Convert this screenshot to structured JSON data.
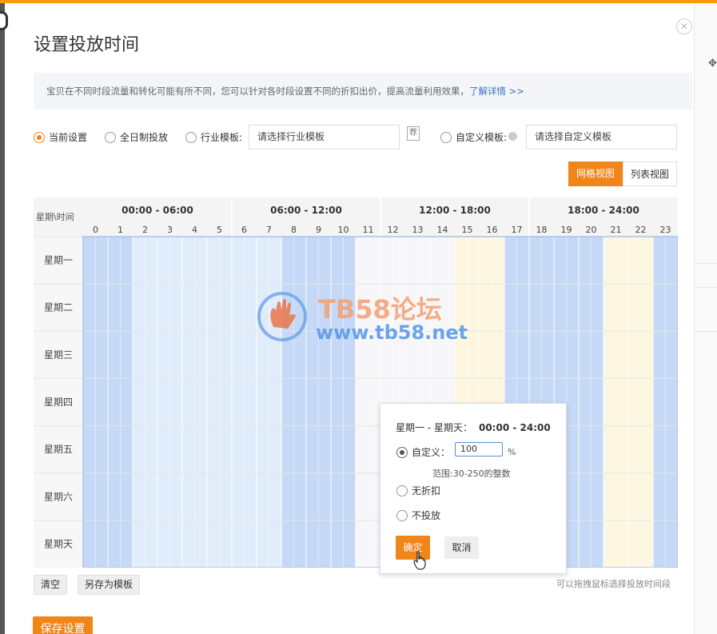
{
  "dialog": {
    "title": "设置投放时间",
    "close_icon": "close-circle-icon",
    "tip_text": "宝贝在不同时段流量和转化可能有所不同，您可以针对各时段设置不同的折扣出价，提高流量利用效果，",
    "tip_link": "了解详情 >>"
  },
  "options": {
    "current": "当前设置",
    "fullday": "全日制投放",
    "industry": "行业模板:",
    "industry_placeholder": "请选择行业模板",
    "custom": "自定义模板:",
    "custom_placeholder": "请选择自定义模板",
    "selected": "current"
  },
  "view_tabs": {
    "grid": "网格视图",
    "list": "列表视图",
    "active": "grid"
  },
  "schedule": {
    "corner_label": "星期\\时间",
    "ranges": [
      "00:00 - 06:00",
      "06:00 - 12:00",
      "12:00 - 18:00",
      "18:00 - 24:00"
    ],
    "hours": [
      "0",
      "1",
      "2",
      "3",
      "4",
      "5",
      "6",
      "7",
      "8",
      "9",
      "10",
      "11",
      "12",
      "13",
      "14",
      "15",
      "16",
      "17",
      "18",
      "19",
      "20",
      "21",
      "22",
      "23"
    ],
    "days": [
      "星期一",
      "星期二",
      "星期三",
      "星期四",
      "星期五",
      "星期六",
      "星期天"
    ],
    "hour_state": [
      "a",
      "a",
      "b",
      "b",
      "b",
      "b",
      "b",
      "b",
      "a",
      "a",
      "a",
      "c",
      "c",
      "c",
      "c",
      "d",
      "d",
      "a",
      "a",
      "a",
      "a",
      "d",
      "d",
      "a"
    ],
    "colors": {
      "a": "#c5d8f6",
      "b": "#e1ecfb",
      "c": "#f7f7f9",
      "d": "#fdf6e0"
    }
  },
  "footer": {
    "clear_label": "清空",
    "save_template_label": "另存为模板",
    "hint": "可以拖拽鼠标选择投放时间段",
    "save_label": "保存设置"
  },
  "popup": {
    "range_label": "星期一 - 星期天：",
    "range_time": "00:00 - 24:00",
    "custom_label": "自定义：",
    "custom_value": "100",
    "percent": "%",
    "range_hint": "范围:30-250的整数",
    "no_discount": "无折扣",
    "no_deliver": "不投放",
    "ok_label": "确定",
    "cancel_label": "取消"
  },
  "watermark": {
    "line1": "TB58论坛",
    "line2": "www.tb58.net"
  }
}
